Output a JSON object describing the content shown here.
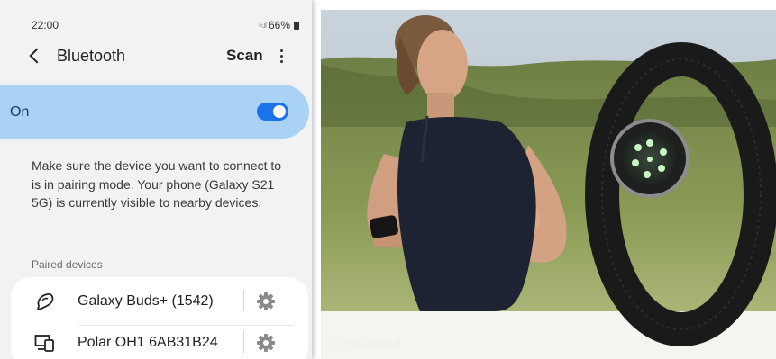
{
  "status_bar": {
    "time": "22:00",
    "battery": "66%"
  },
  "header": {
    "title": "Bluetooth",
    "scan_label": "Scan",
    "back_icon": "chevron-left-icon",
    "more_icon": "more-vertical-icon"
  },
  "bluetooth_toggle": {
    "label": "On",
    "state": true,
    "accent": "#1a73e8",
    "row_color": "#a9d2f4"
  },
  "info_text": "Make sure the device you want to connect to is in pairing mode. Your phone (Galaxy S21 5G) is currently visible to nearby devices.",
  "paired_devices": {
    "header": "Paired devices",
    "items": [
      {
        "name": "Galaxy Buds+ (1542)",
        "icon": "earbuds-icon",
        "settings_icon": "gear-icon"
      },
      {
        "name": "Polar OH1 6AB31B24",
        "icon": "devices-icon",
        "settings_icon": "gear-icon"
      }
    ]
  },
  "photo": {
    "description_icon": "heart-rate-armband-photo",
    "watermark": "Gateshead"
  }
}
